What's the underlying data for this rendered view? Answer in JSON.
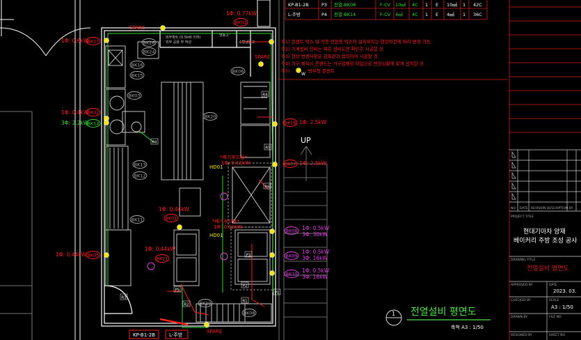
{
  "schedule_table": {
    "rows": [
      {
        "panel": "KP-B1-2B",
        "circuit": "P3",
        "desc": "전열-BK08",
        "cable": "F-CV",
        "size": "10㎟",
        "core": "4C",
        "a": "1",
        "e": "E",
        "esize": "10㎟",
        "n": "1",
        "pipe": "42C"
      },
      {
        "panel": "L-주방",
        "circuit": "P4",
        "desc": "전열-BK14",
        "cable": "F-CV",
        "size": "4㎟",
        "core": "4C",
        "a": "1",
        "e": "E",
        "esize": "4㎟",
        "n": "1",
        "pipe": "36C"
      }
    ]
  },
  "notes": [
    "주1) 콘센트 박스 및 각종 전원용 박스의 설치위치는 현장여건에 따라 변경 가능.",
    "주2) 기계설비 장비는 최종 설비도면 확인후 시공할 것.",
    "주3) 현장 변경사항은 감독관과 협의하여 시공할 것.",
    "주4) 가구 제작시 콘센트는 가구업체랑 타입으로 현장상황에 맞게 설치할 것.",
    "주5)",
    "방우형 콘센트"
  ],
  "note_symbol": "W",
  "plan_labels": {
    "equipment": [
      "BK04",
      "BK17",
      "BK26",
      "BK24",
      "BK16",
      "BK15",
      "BK03",
      "BK02",
      "BK14",
      "BK20",
      "BK06",
      "BK13",
      "BK12",
      "BK11",
      "BK01",
      "BK21",
      "BK05",
      "BK08",
      "BK09",
      "BK10",
      "BK19",
      "BK07",
      "BK18"
    ],
    "loads": {
      "l_bk04": "1Φ: 0.77kW",
      "l_bk17": "1Φ: 0.6kW",
      "l_bk02": "1Φ: 0.4kW",
      "l_bk14": "3Φ: 2.2kW",
      "l_bk18": "1Φ: 2.5kW",
      "l_bk07": "1Φ: 2.5kW",
      "l_bk01": "1Φ: 0.44kW",
      "l_bk21": "1Φ: 0.44kW",
      "l_bk05": "1Φ: 0.44kW",
      "l_bk08a": "1Φ: 0.5kW",
      "l_bk08b": "3Φ: 30kW",
      "l_bk09a": "1Φ: 0.5kW",
      "l_bk09b": "3Φ: 16kW",
      "l_bk10a": "1Φ: 0.5kW",
      "l_bk10b": "3Φ: 16kW",
      "hood1": "1Φ: 0.12kW",
      "hood2": "1Φ: 0.12kW"
    },
    "hood_title": "*배기후드용*",
    "spare": "SPARE",
    "hd": "HD01",
    "up": "UP",
    "points": [
      "P1",
      "P2",
      "P3",
      "P4",
      "P5",
      "R1",
      "R2",
      "R3",
      "R4",
      "R5",
      "R6"
    ],
    "room_note1": "외부파트 (0.5kW 이하)",
    "room_note2": "외부 공용 부 작성",
    "room_note3": "냉동고",
    "room_note4": "소형냉동고",
    "panel_tags": [
      "KP-B1-2B",
      "L-주방"
    ]
  },
  "drawing_title": {
    "number": "1",
    "name": "전열설비 평면도",
    "scale": "축척  A3 : 1/50"
  },
  "title_block": {
    "rev_headers": [
      "NO",
      "DATE",
      "REVISION DESCRIPTION",
      "BY"
    ],
    "project_label": "PROJECT TITLE",
    "project_lines": [
      "현대기아차 양재",
      "베이커리 주방 조성 공사"
    ],
    "drawing_label": "DRAWING TITLE",
    "drawing_name": "전열설비 평면도",
    "approved_label": "APPROVED BY",
    "date_label": "DATE",
    "date_value": "2023. 03.",
    "checked_label": "CHECKED BY",
    "scale_label": "SCALE",
    "scale_value": "A3 : 1/50",
    "drawn_label": "DRAWN BY",
    "file_label": "FILE NO",
    "sheet_label": "SHEET NO",
    "designed_label": "DESIGNED BY"
  },
  "colors": {
    "background": "#000000",
    "wall": "#ffffff",
    "furniture": "#d8d8d8",
    "grid_dim": "#7a7a7a",
    "red": "#ff2020",
    "green": "#33dd33",
    "magenta": "#e040e0",
    "yellow": "#f5e600",
    "title_green": "#4fe04f",
    "titleblock_red": "#cc2020"
  }
}
